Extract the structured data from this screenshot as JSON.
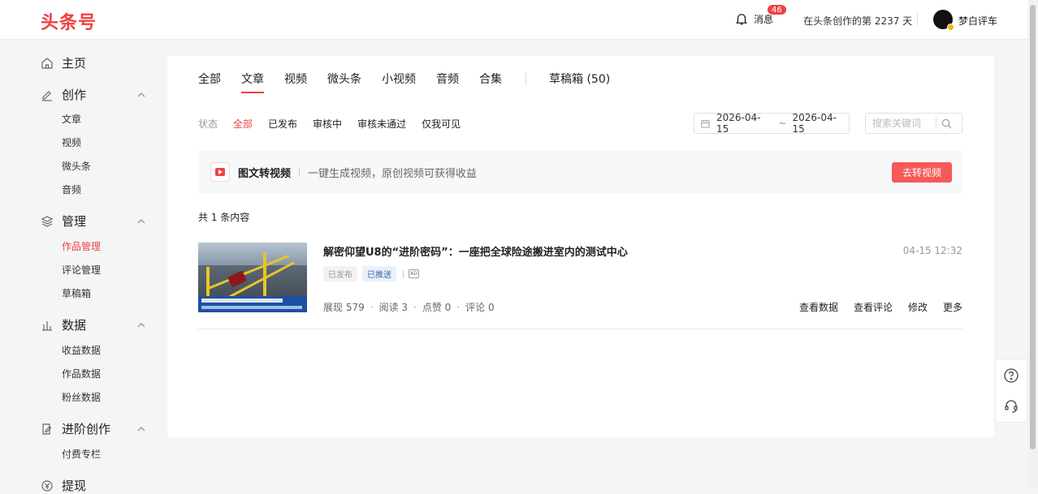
{
  "header": {
    "logo": "头条号",
    "messages_label": "消息",
    "messages_count": "46",
    "days_text": "在头条创作的第 2237 天",
    "username": "梦白评车"
  },
  "sidebar": {
    "home": "主页",
    "create": {
      "label": "创作",
      "items": [
        "文章",
        "视频",
        "微头条",
        "音频"
      ]
    },
    "manage": {
      "label": "管理",
      "items": [
        "作品管理",
        "评论管理",
        "草稿箱"
      ],
      "active": "作品管理"
    },
    "data": {
      "label": "数据",
      "items": [
        "收益数据",
        "作品数据",
        "粉丝数据"
      ]
    },
    "advanced": {
      "label": "进阶创作",
      "items": [
        "付费专栏"
      ]
    },
    "withdraw": "提现"
  },
  "tabs": {
    "items": [
      "全部",
      "文章",
      "视频",
      "微头条",
      "小视频",
      "音频",
      "合集"
    ],
    "active": "文章",
    "drafts": "草稿箱 (50)"
  },
  "filters": {
    "label": "状态",
    "items": [
      "全部",
      "已发布",
      "审核中",
      "审核未通过",
      "仅我可见"
    ],
    "active": "全部",
    "date_start": "2026-04-15",
    "date_end": "2026-04-15",
    "date_separator": "~",
    "search_placeholder": "搜索关键词"
  },
  "promo": {
    "title": "图文转视频",
    "desc": "一键生成视频，原创视频可获得收益",
    "button": "去转视频"
  },
  "total_text": "共 1 条内容",
  "article": {
    "title": "解密仰望U8的“进阶密码”：一座把全球险途搬进室内的测试中心",
    "time": "04-15 12:32",
    "tag_published": "已发布",
    "tag_pushed": "已推送",
    "ad_label": "AD",
    "stats": {
      "views": "展现 579",
      "reads": "阅读 3",
      "likes": "点赞 0",
      "comments": "评论 0"
    },
    "actions": [
      "查看数据",
      "查看评论",
      "修改",
      "更多"
    ]
  },
  "colors": {
    "brand_red": "#f04142",
    "button_red": "#f85959"
  }
}
